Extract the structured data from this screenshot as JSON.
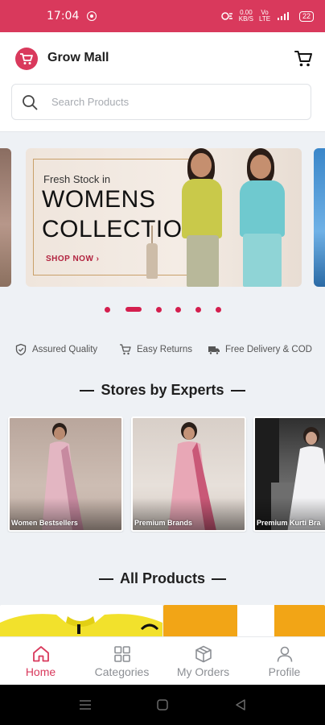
{
  "status_bar": {
    "time": "17:04",
    "network_rate": "0.00",
    "network_unit": "KB/S",
    "signal_tag": "Vo LTE",
    "battery": "22"
  },
  "header": {
    "brand": "Grow Mall",
    "search_placeholder": "Search Products"
  },
  "banner": {
    "kicker": "Fresh Stock in",
    "headline_line1": "WOMENS",
    "headline_line2": "COLLECTION",
    "cta": "SHOP NOW"
  },
  "carousel": {
    "total_slides": 6,
    "active_index": 1
  },
  "features": [
    {
      "label": "Assured Quality",
      "icon": "shield-check-icon"
    },
    {
      "label": "Easy Returns",
      "icon": "cart-return-icon"
    },
    {
      "label": "Free Delivery & COD",
      "icon": "truck-icon"
    }
  ],
  "stores_section": {
    "title": "Stores by Experts",
    "items": [
      {
        "label": "Women Bestsellers"
      },
      {
        "label": "Premium Brands"
      },
      {
        "label": "Premium Kurti Bra"
      }
    ]
  },
  "products_section": {
    "title": "All Products"
  },
  "bottom_nav": {
    "items": [
      {
        "label": "Home",
        "icon": "home-icon",
        "active": true
      },
      {
        "label": "Categories",
        "icon": "grid-icon",
        "active": false
      },
      {
        "label": "My Orders",
        "icon": "box-icon",
        "active": false
      },
      {
        "label": "Profile",
        "icon": "user-icon",
        "active": false
      }
    ]
  },
  "colors": {
    "brand": "#d9395c",
    "accent_dot": "#d41f4e",
    "background": "#eef1f5"
  }
}
